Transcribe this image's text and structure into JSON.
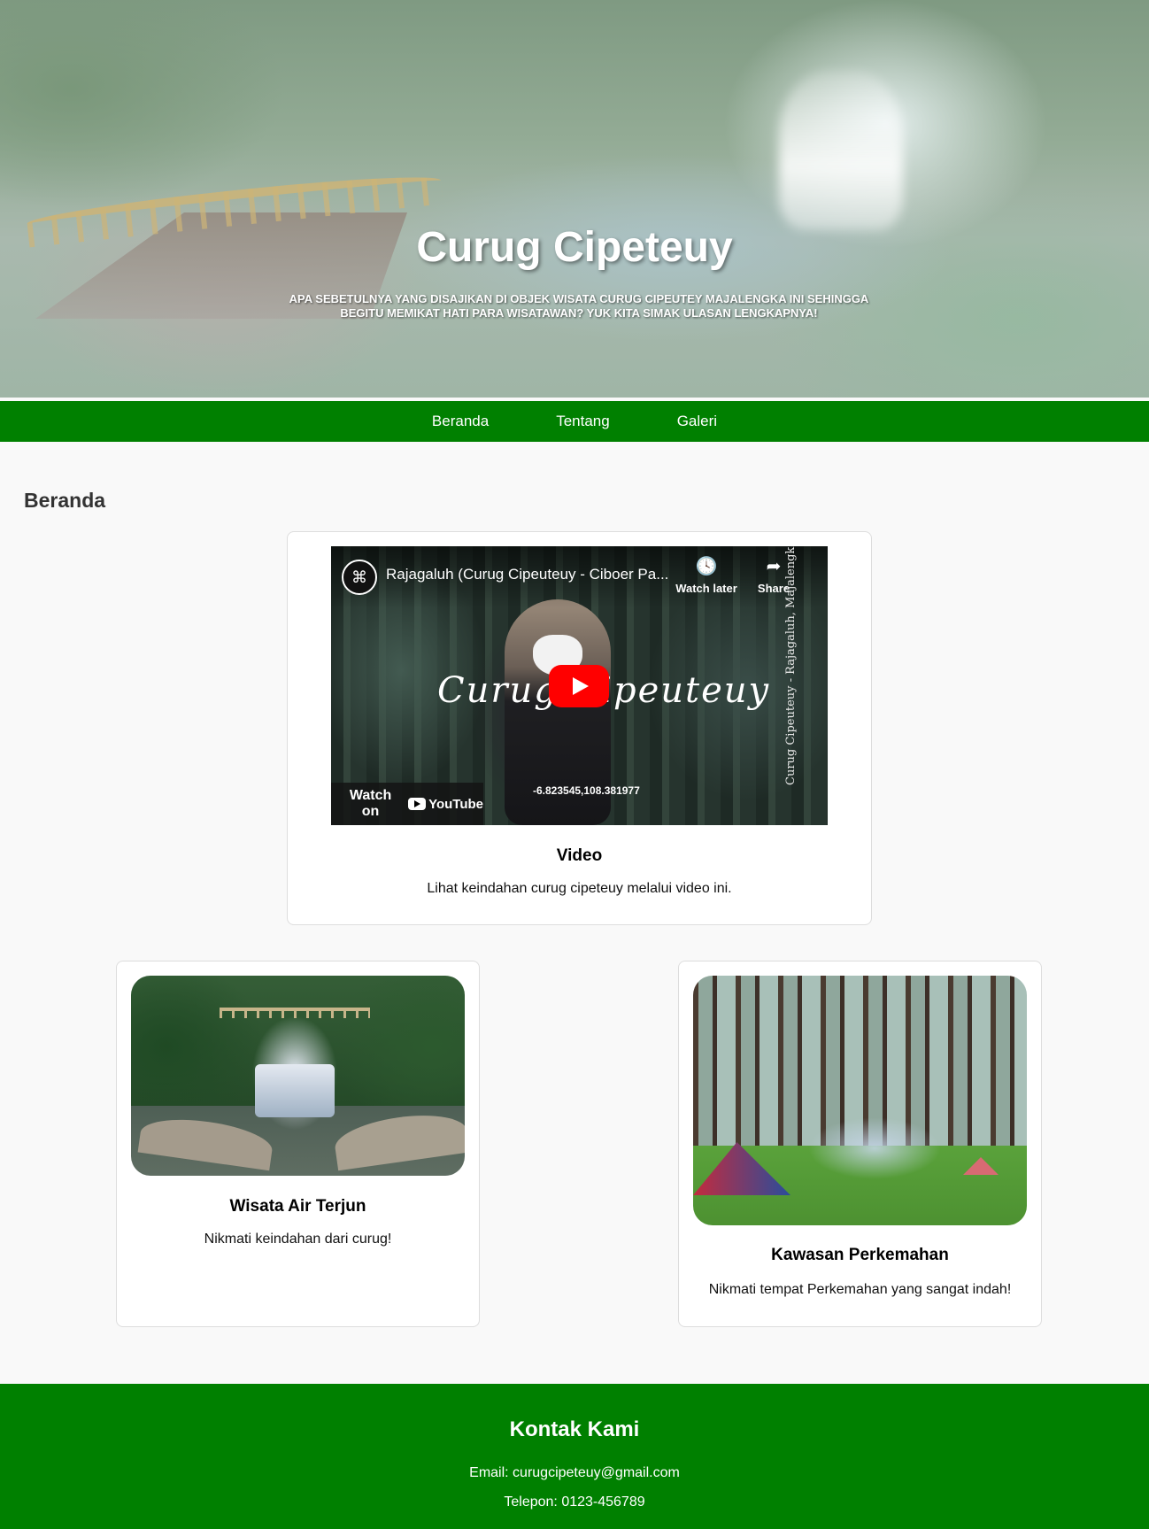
{
  "hero": {
    "title": "Curug Cipeteuy",
    "subtitle": "Apa sebetulnya yang disajikan di objek wisata Curug Cipeutey Majalengka ini sehingga begitu memikat hati para wisatawan? Yuk kita simak ulasan lengkapnya!"
  },
  "nav": {
    "items": [
      {
        "label": "Beranda"
      },
      {
        "label": "Tentang"
      },
      {
        "label": "Galeri"
      }
    ]
  },
  "main": {
    "section_title": "Beranda",
    "video_card": {
      "video": {
        "title": "Rajagaluh (Curug Cipeuteuy - Ciboer Pa...",
        "channel_icon": "channel-logo-icon",
        "watch_later_label": "Watch later",
        "share_label": "Share",
        "overlay_script": "Curug Cipeuteuy",
        "vertical_caption": "Curug Cipeuteuy - Rajagaluh, Majalengka",
        "coords": "-6.823545,108.381977",
        "watch_on_label": "Watch on",
        "youtube_label": "YouTube"
      },
      "title": "Video",
      "description": "Lihat keindahan curug cipeteuy melalui video ini."
    },
    "cards": [
      {
        "title": "Wisata Air Terjun",
        "description": "Nikmati keindahan dari curug!"
      },
      {
        "title": "Kawasan Perkemahan",
        "description": "Nikmati tempat Perkemahan yang sangat indah!"
      }
    ]
  },
  "footer": {
    "title": "Kontak Kami",
    "email": "Email: curugcipeteuy@gmail.com",
    "phone": "Telepon: 0123-456789"
  },
  "colors": {
    "brand_green": "#008000",
    "youtube_red": "#ff0000",
    "background": "#f9f9f9"
  }
}
